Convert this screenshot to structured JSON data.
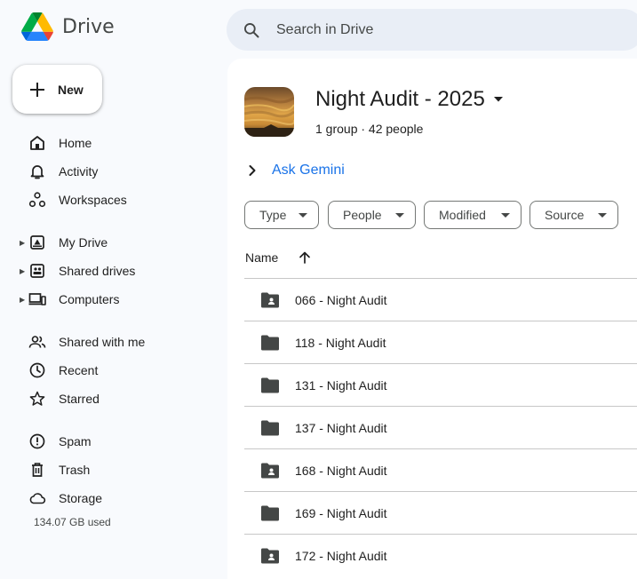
{
  "app": {
    "name": "Drive"
  },
  "search": {
    "placeholder": "Search in Drive"
  },
  "new_button": {
    "label": "New"
  },
  "sidebar": {
    "items": [
      {
        "label": "Home",
        "icon": "home-icon"
      },
      {
        "label": "Activity",
        "icon": "bell-icon"
      },
      {
        "label": "Workspaces",
        "icon": "workspaces-icon"
      },
      {
        "label": "My Drive",
        "icon": "my-drive-icon"
      },
      {
        "label": "Shared drives",
        "icon": "shared-drives-icon"
      },
      {
        "label": "Computers",
        "icon": "computers-icon"
      },
      {
        "label": "Shared with me",
        "icon": "shared-with-me-icon"
      },
      {
        "label": "Recent",
        "icon": "clock-icon"
      },
      {
        "label": "Starred",
        "icon": "star-icon"
      },
      {
        "label": "Spam",
        "icon": "spam-icon"
      },
      {
        "label": "Trash",
        "icon": "trash-icon"
      },
      {
        "label": "Storage",
        "icon": "cloud-icon"
      }
    ],
    "storage_used": "134.07 GB used"
  },
  "header": {
    "title": "Night Audit - 2025",
    "subtitle": "1 group · 42 people"
  },
  "gemini": {
    "label": "Ask Gemini"
  },
  "filters": [
    {
      "label": "Type"
    },
    {
      "label": "People"
    },
    {
      "label": "Modified"
    },
    {
      "label": "Source"
    }
  ],
  "table": {
    "column_name": "Name",
    "rows": [
      {
        "name": "066 - Night Audit",
        "icon": "shared-folder-icon"
      },
      {
        "name": "118 - Night Audit",
        "icon": "folder-icon"
      },
      {
        "name": "131 - Night Audit",
        "icon": "folder-icon"
      },
      {
        "name": "137 - Night Audit",
        "icon": "folder-icon"
      },
      {
        "name": "168 - Night Audit",
        "icon": "shared-folder-icon"
      },
      {
        "name": "169 - Night Audit",
        "icon": "folder-icon"
      },
      {
        "name": "172 - Night Audit",
        "icon": "shared-folder-icon"
      }
    ]
  },
  "colors": {
    "background": "#f8fafd",
    "search_bg": "#e9eef6",
    "accent_blue": "#1a73e8",
    "text": "#1f1f1f",
    "icon": "#444746"
  }
}
